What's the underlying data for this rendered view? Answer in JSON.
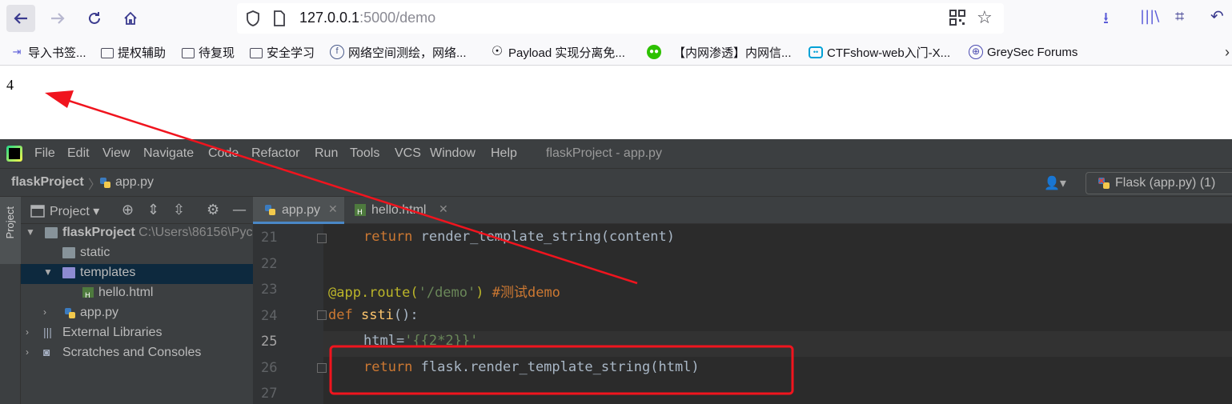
{
  "browser": {
    "url_host": "127.0.0.1",
    "url_path": ":5000/demo",
    "bookmarks": [
      "导入书签...",
      "提权辅助",
      "待复现",
      "安全学习",
      "网络空间测绘，网络...",
      "Payload 实现分离免...",
      "【内网渗透】内网信...",
      "CTFshow-web入门-X...",
      "GreySec Forums"
    ]
  },
  "page": {
    "output": "4"
  },
  "ide": {
    "menu": [
      "File",
      "Edit",
      "View",
      "Navigate",
      "Code",
      "Refactor",
      "Run",
      "Tools",
      "VCS",
      "Window",
      "Help"
    ],
    "title": "flaskProject - app.py",
    "breadcrumb": {
      "project": "flaskProject",
      "file": "app.py"
    },
    "run_config": "Flask (app.py) (1)",
    "strip_label": "Project",
    "project_panel": {
      "title": "Project",
      "tree": [
        {
          "label": "flaskProject",
          "hint": "C:\\Users\\86156\\Pyc"
        },
        {
          "label": "static"
        },
        {
          "label": "templates"
        },
        {
          "label": "hello.html"
        },
        {
          "label": "app.py"
        },
        {
          "label": "External Libraries"
        },
        {
          "label": "Scratches and Consoles"
        }
      ]
    },
    "tabs": [
      "app.py",
      "hello.html"
    ],
    "code": {
      "line_numbers": [
        "21",
        "22",
        "23",
        "24",
        "25",
        "26",
        "27"
      ],
      "l21_kw": "return",
      "l21_rest": " render_template_string(content)",
      "l23_deco": "@app.route(",
      "l23_str": "'/demo'",
      "l23_close": ")",
      "l23_cmt": " #测试demo",
      "l24_kw": "def",
      "l24_fn": "ssti",
      "l24_rest": "():",
      "l25_var": "html=",
      "l25_str": "'{{2*2}}'",
      "l26_kw": "return",
      "l26_rest": " flask.render_template_string(html)"
    }
  }
}
